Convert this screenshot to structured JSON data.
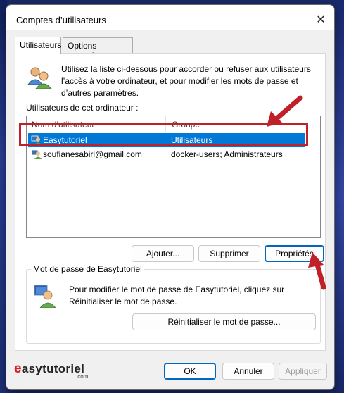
{
  "window": {
    "title": "Comptes d’utilisateurs",
    "close_glyph": "✕"
  },
  "tabs": [
    {
      "label": "Utilisateurs",
      "active": true
    },
    {
      "label": "Options avancées",
      "active": false
    }
  ],
  "intro_text": "Utilisez la liste ci-dessous pour accorder ou refuser aux utilisateurs l’accès à votre ordinateur, et pour modifier les mots de passe et d’autres paramètres.",
  "users_label": "Utilisateurs de cet ordinateur :",
  "list": {
    "columns": [
      "Nom d’utilisateur",
      "Groupe"
    ],
    "rows": [
      {
        "name": "Easytutoriel",
        "group": "Utilisateurs",
        "selected": true,
        "icon": "user-icon"
      },
      {
        "name": "soufianesabiri@gmail.com",
        "group": "docker-users; Administrateurs",
        "selected": false,
        "icon": "user-icon"
      }
    ]
  },
  "buttons": {
    "add": "Ajouter...",
    "remove": "Supprimer",
    "properties": "Propriétés",
    "reset_password": "Réinitialiser le mot de passe...",
    "ok": "OK",
    "cancel": "Annuler",
    "apply": "Appliquer"
  },
  "password_group": {
    "title": "Mot de passe de Easytutoriel",
    "text": "Pour modifier le mot de passe de Easytutoriel, cliquez sur Réinitialiser le mot de passe."
  },
  "watermark": {
    "brand": "easytutoriel",
    "brand_initial": "e",
    "sub": ".com"
  },
  "colors": {
    "selection": "#0078d7",
    "highlight": "#c0202a",
    "default_button_border": "#0067c0"
  }
}
